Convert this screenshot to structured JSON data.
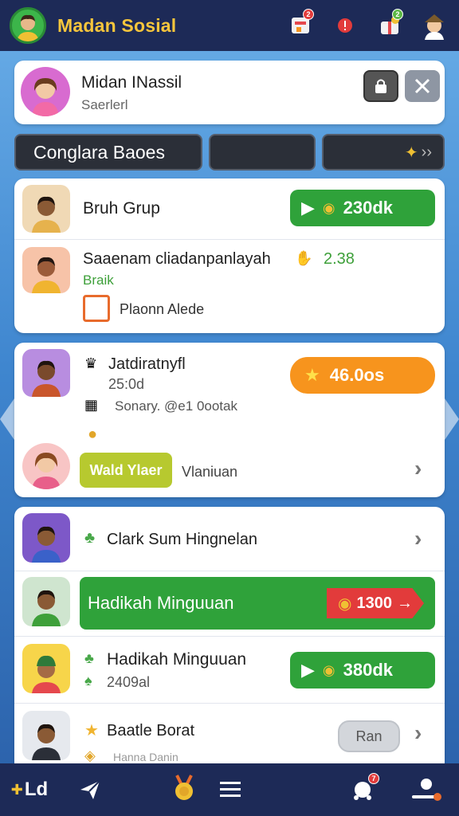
{
  "app": {
    "title": "Madan Sosial"
  },
  "header": {
    "icons": [
      {
        "name": "notification-icon",
        "badge": "2"
      },
      {
        "name": "alert-icon",
        "badge": "2"
      },
      {
        "name": "gift-icon",
        "badge": "2"
      },
      {
        "name": "profile-icon"
      }
    ]
  },
  "profile": {
    "name": "Midan INassil",
    "subtitle": "Saerlerl"
  },
  "tabs": {
    "active_label": "Conglara Baoes",
    "more_label": "+ >>"
  },
  "group_card": {
    "item1": {
      "name": "Bruh Grup",
      "action_value": "230dk"
    },
    "item2": {
      "title": "Saaenam cliadanpanlayah",
      "value": "2.38",
      "sub": "Braik",
      "extra": "Plaonn Alede"
    }
  },
  "challenge_card": {
    "title": "Jatdiratnyfl",
    "time": "25:0d",
    "meta": "Sonary. @e1 0ootak",
    "reward": "46.0os",
    "button_label": "Wald Ylaer",
    "secondary": "Vlaniuan"
  },
  "list_card": {
    "item1": {
      "title": "Clark Sum Hingnelan"
    },
    "item2": {
      "title": "Hadikah Minguuan",
      "tag": "1300"
    },
    "item3": {
      "title": "Hadikah Minguuan",
      "sub": "2409al",
      "action_value": "380dk"
    },
    "item4": {
      "title": "Baatle Borat",
      "button": "Ran",
      "sub": "Hanna Danin"
    }
  },
  "bottom_nav": {
    "home_label": "Ld"
  },
  "colors": {
    "accent_green": "#2fa23a",
    "accent_orange": "#f7941d",
    "bar_navy": "#1d2a57",
    "title_yellow": "#f7c63c"
  }
}
